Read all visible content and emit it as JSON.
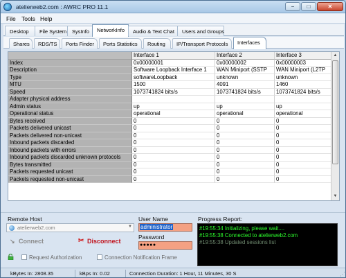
{
  "window": {
    "title": "atelierweb2.com : AWRC PRO 11.1",
    "min_label": "−",
    "max_label": "□",
    "close_label": "✕"
  },
  "menu": [
    "File",
    "Tools",
    "Help"
  ],
  "main_tabs": [
    "Desktop",
    "File System",
    "SysInfo",
    "NetworkInfo",
    "Audio & Text Chat",
    "Users and Groups"
  ],
  "main_tabs_active": "NetworkInfo",
  "sub_tabs": [
    "Shares",
    "RDS/TS",
    "Ports Finder",
    "Ports Statistics",
    "Routing",
    "IP/Transport Protocols",
    "Interfaces"
  ],
  "sub_tabs_active": "Interfaces",
  "grid": {
    "headers": [
      "",
      "Interface 1",
      "Interface 2",
      "Interface 3"
    ],
    "rows": [
      [
        "Index",
        "0x00000001",
        "0x00000002",
        "0x00000003"
      ],
      [
        "Description",
        "Software Loopback Interface 1",
        "WAN Miniport (SSTP",
        "WAN Miniport (L2TP"
      ],
      [
        "Type",
        "softwareLoopback",
        "unknown",
        "unknown"
      ],
      [
        "MTU",
        "1500",
        "4091",
        "1460"
      ],
      [
        "Speed",
        "1073741824 bits/s",
        "1073741824 bits/s",
        "1073741824 bits/s"
      ],
      [
        "Adapter physical address",
        "",
        "",
        ""
      ],
      [
        "Admin status",
        "up",
        "up",
        "up"
      ],
      [
        "Operational status",
        "operational",
        "operational",
        "operational"
      ],
      [
        "Bytes received",
        "0",
        "0",
        "0"
      ],
      [
        "Packets delivered unicast",
        "0",
        "0",
        "0"
      ],
      [
        "Packets delivered non-unicast",
        "0",
        "0",
        "0"
      ],
      [
        "Inbound packets discarded",
        "0",
        "0",
        "0"
      ],
      [
        "Inbound packets with errors",
        "0",
        "0",
        "0"
      ],
      [
        "Inbound packets discarded unknown protocols",
        "0",
        "0",
        "0"
      ],
      [
        "Bytes transmitted",
        "0",
        "0",
        "0"
      ],
      [
        "Packets requested unicast",
        "0",
        "0",
        "0"
      ],
      [
        "Packets requested non-unicast",
        "0",
        "0",
        "0"
      ]
    ]
  },
  "remote": {
    "host_label": "Remote Host",
    "host_value": "atelierweb2.com",
    "connect_label": "Connect",
    "disconnect_label": "Disconnect",
    "request_auth_label": "Request Authorization",
    "conn_notif_label": "Connection Notification Frame"
  },
  "login": {
    "username_label": "User Name",
    "username_value": "administrator",
    "password_label": "Password",
    "password_value": "●●●●●"
  },
  "progress": {
    "label": "Progress Report:",
    "lines": [
      {
        "text": "#19:55:34 Initializing, please wait....",
        "state": "ok"
      },
      {
        "text": "#19:55:38 Connected to atelierweb2.com",
        "state": "ok"
      },
      {
        "text": "#19:55:38 Updated sessions list",
        "state": "dim"
      }
    ]
  },
  "status": {
    "kbytes_in": "kBytes In:  2808.35",
    "kbps_in": "kBps In:  0.02",
    "duration": "Connection Duration:  1 Hour, 11 Minutes, 30 S"
  },
  "colors": {
    "accent": "#1d61c9",
    "error": "#c0101a",
    "log_ok": "#2dff2d"
  }
}
